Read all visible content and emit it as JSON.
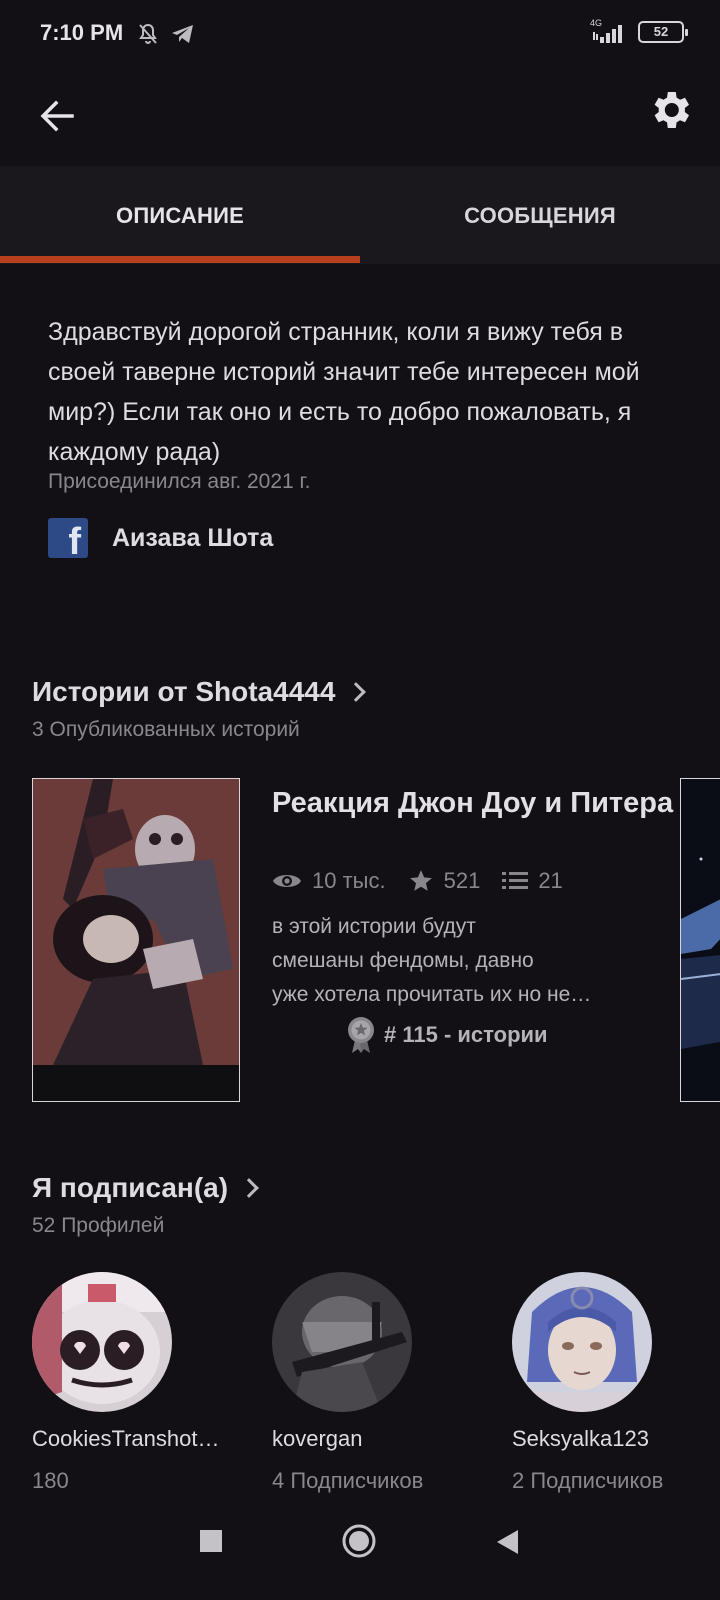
{
  "status_bar": {
    "time": "7:10 PM",
    "network": "4G",
    "battery": "52",
    "icons": [
      "muted-bell-icon",
      "telegram-icon",
      "signal-icon",
      "battery-icon"
    ]
  },
  "app_bar": {
    "icons": [
      "back-arrow-icon",
      "gear-icon"
    ]
  },
  "tabs": [
    {
      "label": "ОПИСАНИЕ",
      "active": true
    },
    {
      "label": "СООБЩЕНИЯ",
      "active": false
    }
  ],
  "colors": {
    "accent": "#b8401d",
    "background": "#121015",
    "tabs_bg": "#1a181c",
    "muted_text": "#8a878c"
  },
  "about": {
    "bio": "Здравствуй дорогой странник, коли я вижу тебя в своей таверне историй значит тебе интересен мой мир?) Если так оно и есть то добро пожаловать, я каждому рада)",
    "joined": "Присоединился авг. 2021 г.",
    "facebook_name": "Аизава Шота",
    "facebook_icon": "facebook-icon"
  },
  "stories": {
    "title": "Истории от Shota4444",
    "subtitle": "3 Опубликованных историй",
    "items": [
      {
        "title": "Реакция Джон Доу и Питера",
        "views": "10 тыс.",
        "votes": "521",
        "parts": "21",
        "description_lines": [
          "в этой истории будут",
          "смешаны фендомы, давно",
          "уже хотела прочитать их но не…"
        ],
        "rank": "# 115 - истории"
      }
    ]
  },
  "following": {
    "title": "Я подписан(а)",
    "subtitle": "52 Профилей",
    "profiles": [
      {
        "name": "CookiesTranshot…",
        "followers": "180"
      },
      {
        "name": "kovergan",
        "followers": "4 Подписчиков"
      },
      {
        "name": "Seksyalka123",
        "followers": "2 Подписчиков"
      }
    ]
  },
  "nav_bar": {
    "icons": [
      "recents-square-icon",
      "home-circle-icon",
      "back-triangle-icon"
    ]
  }
}
